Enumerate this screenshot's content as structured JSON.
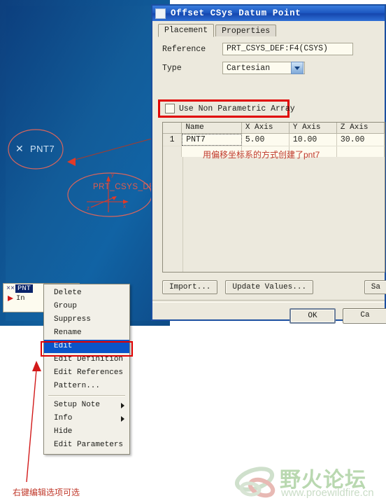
{
  "dialog": {
    "title": "Offset CSys Datum Point",
    "title_icon": "window-icon",
    "tabs": [
      {
        "label": "Placement",
        "active": true
      },
      {
        "label": "Properties",
        "active": false
      }
    ],
    "reference": {
      "label": "Reference",
      "value": "PRT_CSYS_DEF:F4(CSYS)"
    },
    "type": {
      "label": "Type",
      "value": "Cartesian",
      "arrow_icon": "chevron-down-icon"
    },
    "non_parametric": {
      "label": "Use Non Parametric Array",
      "checked": false
    },
    "table": {
      "headers": [
        "",
        "Name",
        "X Axis",
        "Y Axis",
        "Z Axis"
      ],
      "rows": [
        {
          "index": "1",
          "name": "PNT7",
          "x": "5.00",
          "y": "10.00",
          "z": "30.00"
        }
      ],
      "empty_rows": 2
    },
    "note_zh": "用偏移坐标系的方式创建了pnt7",
    "buttons": {
      "import": "Import...",
      "update_values": "Update Values...",
      "save": "Sa",
      "ok": "OK",
      "cancel": "Ca"
    }
  },
  "viewport": {
    "point_label": "PNT7",
    "point_marker": "x-marker",
    "csys_label": "PRT_CSYS_DE",
    "csys_axis_x": "x",
    "csys_axis_y": "y",
    "csys_axis_z": "z"
  },
  "model_tree": {
    "selected_item": "PNT",
    "insert_item": "In",
    "insert_icon": "insert-arrow-icon"
  },
  "context_menu": {
    "items": [
      {
        "label": "Delete",
        "selected": false,
        "submenu": false
      },
      {
        "label": "Group",
        "selected": false,
        "submenu": false
      },
      {
        "label": "Suppress",
        "selected": false,
        "submenu": false
      },
      {
        "label": "Rename",
        "selected": false,
        "submenu": false
      },
      {
        "label": "Edit",
        "selected": true,
        "submenu": false
      },
      {
        "label": "Edit Definition",
        "selected": false,
        "submenu": false
      },
      {
        "label": "Edit References",
        "selected": false,
        "submenu": false
      },
      {
        "label": "Pattern...",
        "selected": false,
        "submenu": false
      },
      {
        "label": "Setup Note",
        "selected": false,
        "submenu": true
      },
      {
        "label": "Info",
        "selected": false,
        "submenu": true
      },
      {
        "label": "Hide",
        "selected": false,
        "submenu": false
      },
      {
        "label": "Edit Parameters",
        "selected": false,
        "submenu": false
      }
    ]
  },
  "annotations": {
    "bottom_note_zh": "右键编辑选项可选"
  },
  "watermark": {
    "text": "野火论坛",
    "url": "www.proewildfire.cn"
  },
  "colors": {
    "annotation_red": "#e00000",
    "viewport_blue": "#115e9c",
    "titlebar_blue": "#1c56c0",
    "dialog_bg": "#ece9dd",
    "menu_highlight": "#0a54c8"
  }
}
